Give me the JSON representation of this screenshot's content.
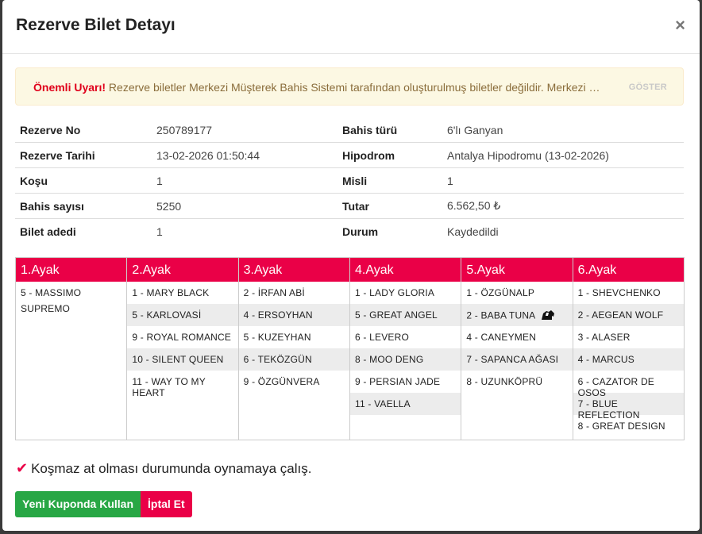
{
  "modal": {
    "title": "Rezerve Bilet Detayı",
    "close_label": "×"
  },
  "alert": {
    "strong": "Önemli Uyarı!",
    "text": " Rezerve biletler Merkezi Müşterek Bahis Sistemi tarafından oluşturulmuş biletler değildir. Merkezi Mü...",
    "show_label": "GÖSTER"
  },
  "info": {
    "rows": [
      {
        "k1": "Rezerve No",
        "v1": "250789177",
        "k2": "Bahis türü",
        "v2": "6'lı Ganyan"
      },
      {
        "k1": "Rezerve Tarihi",
        "v1": "13-02-2026 01:50:44",
        "k2": "Hipodrom",
        "v2": "Antalya Hipodromu (13-02-2026)"
      },
      {
        "k1": "Koşu",
        "v1": "1",
        "k2": "Misli",
        "v2": "1"
      },
      {
        "k1": "Bahis sayısı",
        "v1": "5250",
        "k2": "Tutar",
        "v2": "6.562,50 ₺"
      },
      {
        "k1": "Bilet adedi",
        "v1": "1",
        "k2": "Durum",
        "v2": "Kaydedildi"
      }
    ]
  },
  "legs": [
    {
      "title": "1.Ayak",
      "runners": [
        "5 - MASSIMO SUPREMO"
      ]
    },
    {
      "title": "2.Ayak",
      "runners": [
        "1 - MARY BLACK",
        "5 - KARLOVASİ",
        "9 - ROYAL ROMANCE",
        "10 - SILENT QUEEN",
        "11 - WAY TO MY HEART"
      ]
    },
    {
      "title": "3.Ayak",
      "runners": [
        "2 - İRFAN ABİ",
        "4 - ERSOYHAN",
        "5 - KUZEYHAN",
        "6 - TEKÖZGÜN",
        "9 - ÖZGÜNVERA"
      ]
    },
    {
      "title": "4.Ayak",
      "runners": [
        "1 - LADY GLORIA",
        "5 - GREAT ANGEL",
        "6 - LEVERO",
        "8 - MOO DENG",
        "9 - PERSIAN JADE",
        "11 - VAELLA"
      ]
    },
    {
      "title": "5.Ayak",
      "runners": [
        "1 - ÖZGÜNALP",
        "2 - BABA TUNA",
        "4 - CANEYMEN",
        "7 - SAPANCA AĞASI",
        "8 - UZUNKÖPRÜ"
      ]
    },
    {
      "title": "6.Ayak",
      "runners": [
        "1 - SHEVCHENKO",
        "2 - AEGEAN WOLF",
        "3 - ALASER",
        "4 - MARCUS",
        "6 - CAZATOR DE OSOS",
        "7 - BLUE REFLECTION",
        "8 - GREAT DESIGN"
      ]
    }
  ],
  "note": {
    "icon": "check-icon",
    "text": "Koşmaz at olması durumunda oynamaya çalış."
  },
  "buttons": {
    "new_coupon": "Yeni Kuponda Kullan",
    "cancel": "İptal Et"
  },
  "colors": {
    "accent": "#ea0047",
    "success": "#28a745",
    "alert_bg": "#fcf8e3"
  }
}
